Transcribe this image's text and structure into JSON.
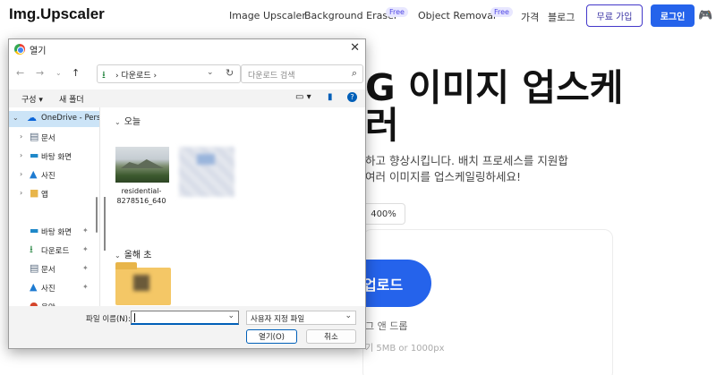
{
  "site": {
    "logo": "Img.Upscaler",
    "nav": {
      "image_upscaler": "Image Upscaler",
      "background_eraser": "Background Eraser",
      "object_removal": "Object Removal",
      "pricing": "가격",
      "blog": "블로그",
      "free_badge": "Free"
    },
    "signup_label": "무료 가입",
    "login_label": "로그인",
    "hero": {
      "title_line1": "G 이미지 업스케",
      "title_line2": "러",
      "subtitle_line1": "하고 향상시킵니다. 배치 프로세스를 지원합",
      "subtitle_line2": "여러 이미지를 업스케일링하세요!",
      "scale_option": "400%",
      "upload_label": "업로드",
      "drop_text": "그 앤 드롭",
      "limit_text": "기 5MB or 1000px"
    },
    "accent_color": "#2563eb"
  },
  "dialog": {
    "title": "열기",
    "close": "✕",
    "address": {
      "path": "다운로드",
      "separator": "›"
    },
    "search_placeholder": "다운로드 검색",
    "toolbar": {
      "organize": "구성 ▾",
      "new_folder": "새 폴더"
    },
    "sidebar": [
      {
        "label": "OneDrive - Pers",
        "icon": "onedrive-icon"
      },
      {
        "label": "문서",
        "icon": "documents-icon"
      },
      {
        "label": "바탕 화면",
        "icon": "desktop-icon"
      },
      {
        "label": "사진",
        "icon": "pictures-icon"
      },
      {
        "label": "앱",
        "icon": "folder-icon"
      },
      {
        "label": "바탕 화면",
        "icon": "desktop-icon"
      },
      {
        "label": "다운로드",
        "icon": "download-icon"
      },
      {
        "label": "문서",
        "icon": "documents-icon"
      },
      {
        "label": "사진",
        "icon": "pictures-icon"
      },
      {
        "label": "음악",
        "icon": "music-icon"
      }
    ],
    "groups": {
      "today": "오늘",
      "earlier_this_year": "올해 초"
    },
    "files": [
      {
        "name": "residential-8278516_640"
      }
    ],
    "filename_label": "파일 이름(N):",
    "filename_value": "",
    "filter_value": "사용자 지정 파일",
    "open_label": "열기(O)",
    "cancel_label": "취소"
  }
}
